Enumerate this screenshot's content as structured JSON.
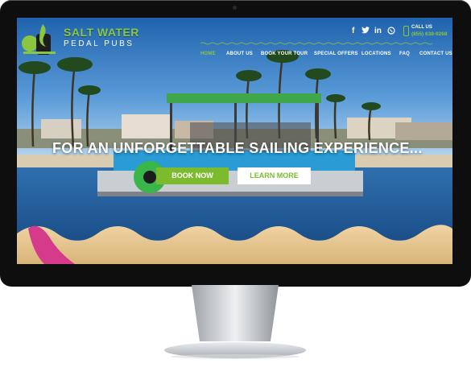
{
  "brand": {
    "name_line1": "SALT WATER",
    "name_line2": "PEDAL PUBS"
  },
  "social": {
    "facebook": "f",
    "twitter": "twitter-icon",
    "linkedin": "in",
    "whatsapp": "whatsapp-icon"
  },
  "call": {
    "label": "CALL US",
    "number": "(855) 638-9268"
  },
  "nav": {
    "items": [
      {
        "label": "HOME",
        "active": true
      },
      {
        "label": "ABOUT US",
        "active": false
      },
      {
        "label": "BOOK YOUR TOUR",
        "active": false
      },
      {
        "label": "SPECIAL OFFERS",
        "active": false
      },
      {
        "label": "LOCATIONS",
        "active": false
      },
      {
        "label": "FAQ",
        "active": false
      },
      {
        "label": "CONTACT US",
        "active": false
      }
    ]
  },
  "hero": {
    "headline": "FOR AN UNFORGETTABLE SAILING EXPERIENCE...",
    "book_label": "BOOK NOW",
    "learn_label": "LEARN MORE"
  },
  "colors": {
    "accent": "#8bc63f",
    "button_green": "#7dbb2e",
    "sky": "#2a73b8",
    "water": "#1e5a9c",
    "sand": "#e6c48f",
    "monitor_bezel": "#0e0e0e",
    "stand_silver": "#c9cdd1"
  }
}
